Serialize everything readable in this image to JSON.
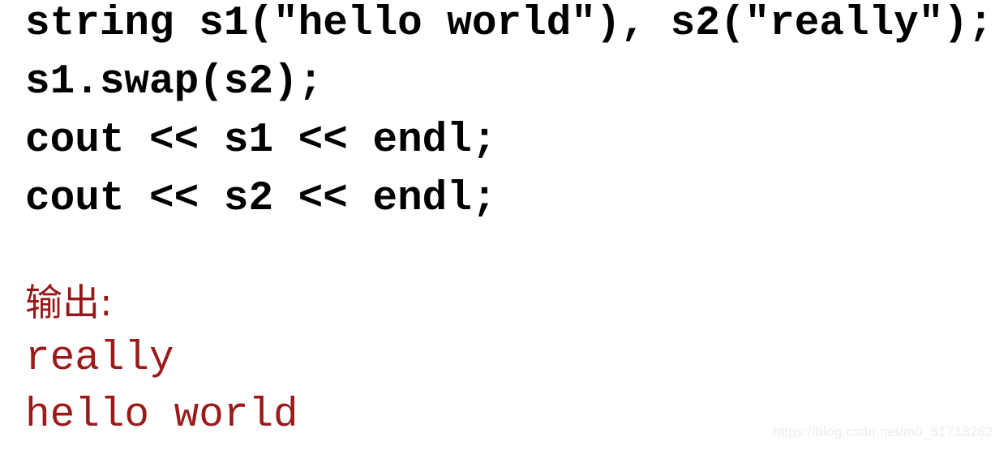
{
  "page": {
    "background_color": "#ffffff",
    "code_color": "#000000",
    "output_color": "#9b1b1b",
    "heading_color": "#971818",
    "watermark_color": "#ededed"
  },
  "code": {
    "language": "cpp",
    "lines": [
      "string s1(\"hello world\"), s2(\"really\");",
      "s1.swap(s2);",
      "cout << s1 << endl;",
      "cout << s2 << endl;"
    ]
  },
  "output": {
    "heading": "输出:",
    "lines": [
      "really",
      "hello world"
    ]
  },
  "watermark": {
    "text": "https://blog.csdn.net/m0_51718262"
  }
}
